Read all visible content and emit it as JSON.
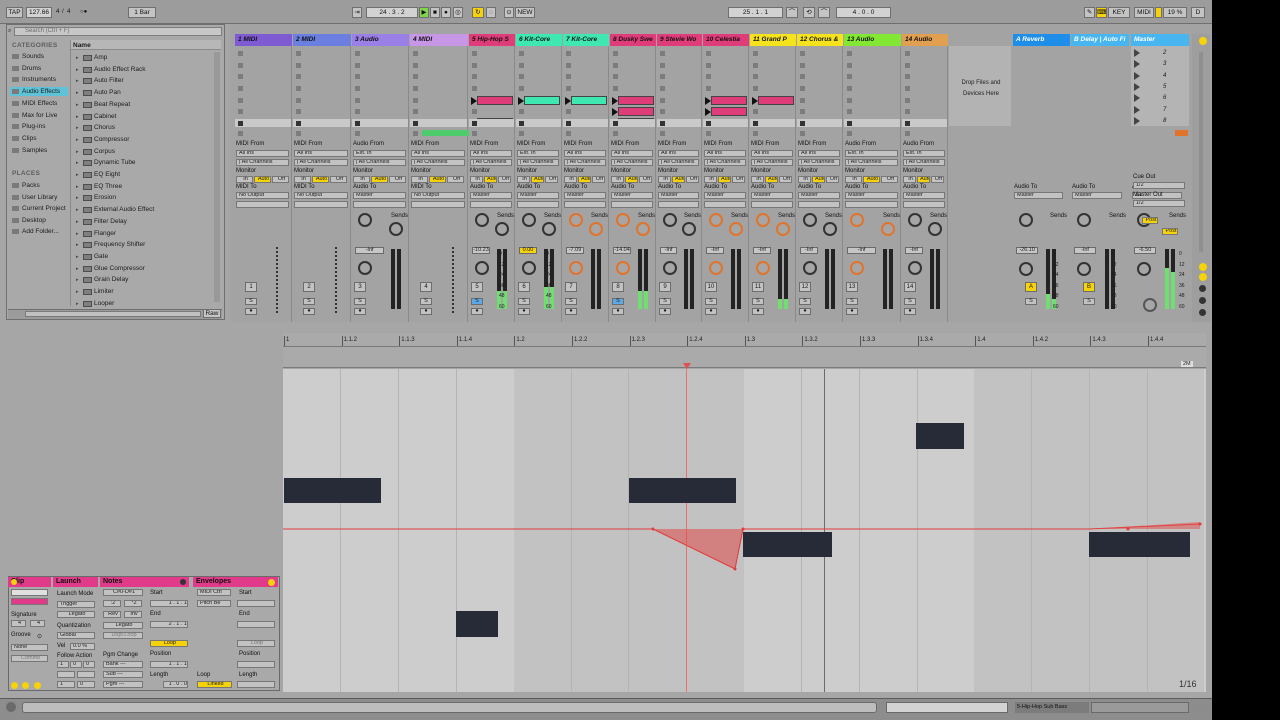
{
  "transport": {
    "tap": "TAP",
    "tempo": "127.66",
    "sig_num": "4",
    "sig_den": "4",
    "metro": "○●",
    "quant": "1 Bar",
    "pos1": "24",
    "pos2": "3",
    "pos3": "2",
    "new_label": "NEW",
    "loop1": "25",
    "loop2": "1",
    "loop3": "1",
    "len1": "4",
    "len2": "0",
    "len3": "0",
    "key": "KEY",
    "midi": "MIDI",
    "cpu": "19 %",
    "d": "D"
  },
  "browser": {
    "search_placeholder": "Search (Ctrl + F)",
    "categories_header": "CATEGORIES",
    "places_header": "PLACES",
    "name_header": "Name",
    "categories": [
      "Sounds",
      "Drums",
      "Instruments",
      "Audio Effects",
      "MIDI Effects",
      "Max for Live",
      "Plug-ins",
      "Clips",
      "Samples"
    ],
    "selected_category": "Audio Effects",
    "places": [
      "Packs",
      "User Library",
      "Current Project",
      "Desktop",
      "Add Folder..."
    ],
    "items": [
      "Amp",
      "Audio Effect Rack",
      "Auto Filter",
      "Auto Pan",
      "Beat Repeat",
      "Cabinet",
      "Chorus",
      "Compressor",
      "Corpus",
      "Dynamic Tube",
      "EQ Eight",
      "EQ Three",
      "Erosion",
      "External Audio Effect",
      "Filter Delay",
      "Flanger",
      "Frequency Shifter",
      "Gate",
      "Glue Compressor",
      "Grain Delay",
      "Limiter",
      "Looper"
    ],
    "raw_label": "Raw"
  },
  "tracks": [
    {
      "name": "1 MIDI",
      "color": "#7e5bd2"
    },
    {
      "name": "2 MIDI",
      "color": "#6a7fe0"
    },
    {
      "name": "3 Audio",
      "color": "#9a7fe6"
    },
    {
      "name": "4 MIDI",
      "color": "#c896e6"
    },
    {
      "name": "5 Hip-Hop S",
      "color": "#df3d7a"
    },
    {
      "name": "6 Kit-Core",
      "color": "#3ee8b0"
    },
    {
      "name": "7 Kit-Core",
      "color": "#3ee8b0"
    },
    {
      "name": "8 Dusky Swe",
      "color": "#df3d7a"
    },
    {
      "name": "9 Stevie Wo",
      "color": "#df3d7a"
    },
    {
      "name": "10 Celestia",
      "color": "#df3d7a"
    },
    {
      "name": "11 Grand P",
      "color": "#f5e31e"
    },
    {
      "name": "12 Chorus &",
      "color": "#f5e31e"
    },
    {
      "name": "13 Audio",
      "color": "#82e834"
    },
    {
      "name": "14 Audio",
      "color": "#e0a050"
    }
  ],
  "returns": [
    {
      "name": "A Reverb",
      "color": "#1f8ee8"
    },
    {
      "name": "B Delay | Auto Fi",
      "color": "#47b6f0"
    },
    {
      "name": "Master",
      "color": "#47b6f0"
    }
  ],
  "drop_text": "Drop Files and Devices Here",
  "io": {
    "midi_from": "MIDI From",
    "audio_from": "Audio From",
    "all_ins": "All Ins",
    "ext_in": "Ext. In",
    "all_channels": "| All Channels",
    "monitor": "Monitor",
    "in": "In",
    "auto": "Auto",
    "off": "Off",
    "midi_to": "MIDI To",
    "audio_to": "Audio To",
    "no_output": "No Output",
    "master": "Master",
    "sends": "Sends",
    "cue_out": "Cue Out",
    "cue_val": "1/2",
    "master_out": "Master Out",
    "master_out_val": "1/2",
    "post": "Post",
    "neg_inf": "-Inf"
  },
  "volumes": [
    "",
    "",
    "-Inf",
    "",
    "-10.23",
    "0.00",
    "-7.09",
    "-14.04",
    "-Inf",
    "-Inf",
    "-Inf",
    "-Inf",
    "-Inf",
    "-Inf"
  ],
  "return_volumes": [
    "-26.10",
    "-Inf",
    "-6.50"
  ],
  "track_numbers": [
    "1",
    "2",
    "3",
    "4",
    "5",
    "6",
    "7",
    "8",
    "9",
    "10",
    "11",
    "12",
    "13",
    "14"
  ],
  "meter_scale": [
    "0",
    "12",
    "24",
    "36",
    "48",
    "60"
  ],
  "scene_numbers": [
    "2",
    "3",
    "4",
    "5",
    "6",
    "7",
    "8"
  ],
  "ruler": {
    "labels": [
      "1",
      "1.1.2",
      "1.1.3",
      "1.1.4",
      "1.2",
      "1.2.2",
      "1.2.3",
      "1.2.4",
      "1.3",
      "1.3.2",
      "1.3.3",
      "1.3.4",
      "1.4",
      "1.4.2",
      "1.4.3",
      "1.4.4"
    ],
    "end_label": "2M"
  },
  "zoom": "1/16",
  "clip_panel": {
    "clip": "Clip",
    "launch": "Launch",
    "notes": "Notes",
    "envelopes": "Envelopes",
    "signature": "Signature",
    "sig_num": "4",
    "sig_den": "4",
    "groove": "Groove",
    "groove_val": "None",
    "commit": "Commit",
    "launch_mode": "Launch Mode",
    "trigger": "Trigger",
    "legato": "Legato",
    "quantization": "Quantization",
    "global": "Global",
    "vel": "Vel",
    "vel_val": "0.0 %",
    "follow_action": "Follow Action",
    "fa_a": "1",
    "fa_b": "0",
    "fa_c": "0",
    "fa_d": "1",
    "key_range": "C#0-D#1",
    "dup_loop": "Dupl.Loop",
    "pgm_change": "Pgm Change",
    "bank": "Bank ---",
    "sub": "Sub ---",
    "pgm": "Pgm ---",
    "start": "Start",
    "end": "End",
    "set": "Set",
    "loop": "Loop",
    "position": "Position",
    "length": "Length",
    "env_a": "MIDI Ctrl",
    "env_b": "Pitch Be",
    "linked": "Linked",
    "div2": ":2",
    "x2": "*2",
    "rev": "Rev",
    "inv": "Inv",
    "legato2": "Legato"
  },
  "status": {
    "track": "5-Hip-Hop Sub Bass"
  }
}
